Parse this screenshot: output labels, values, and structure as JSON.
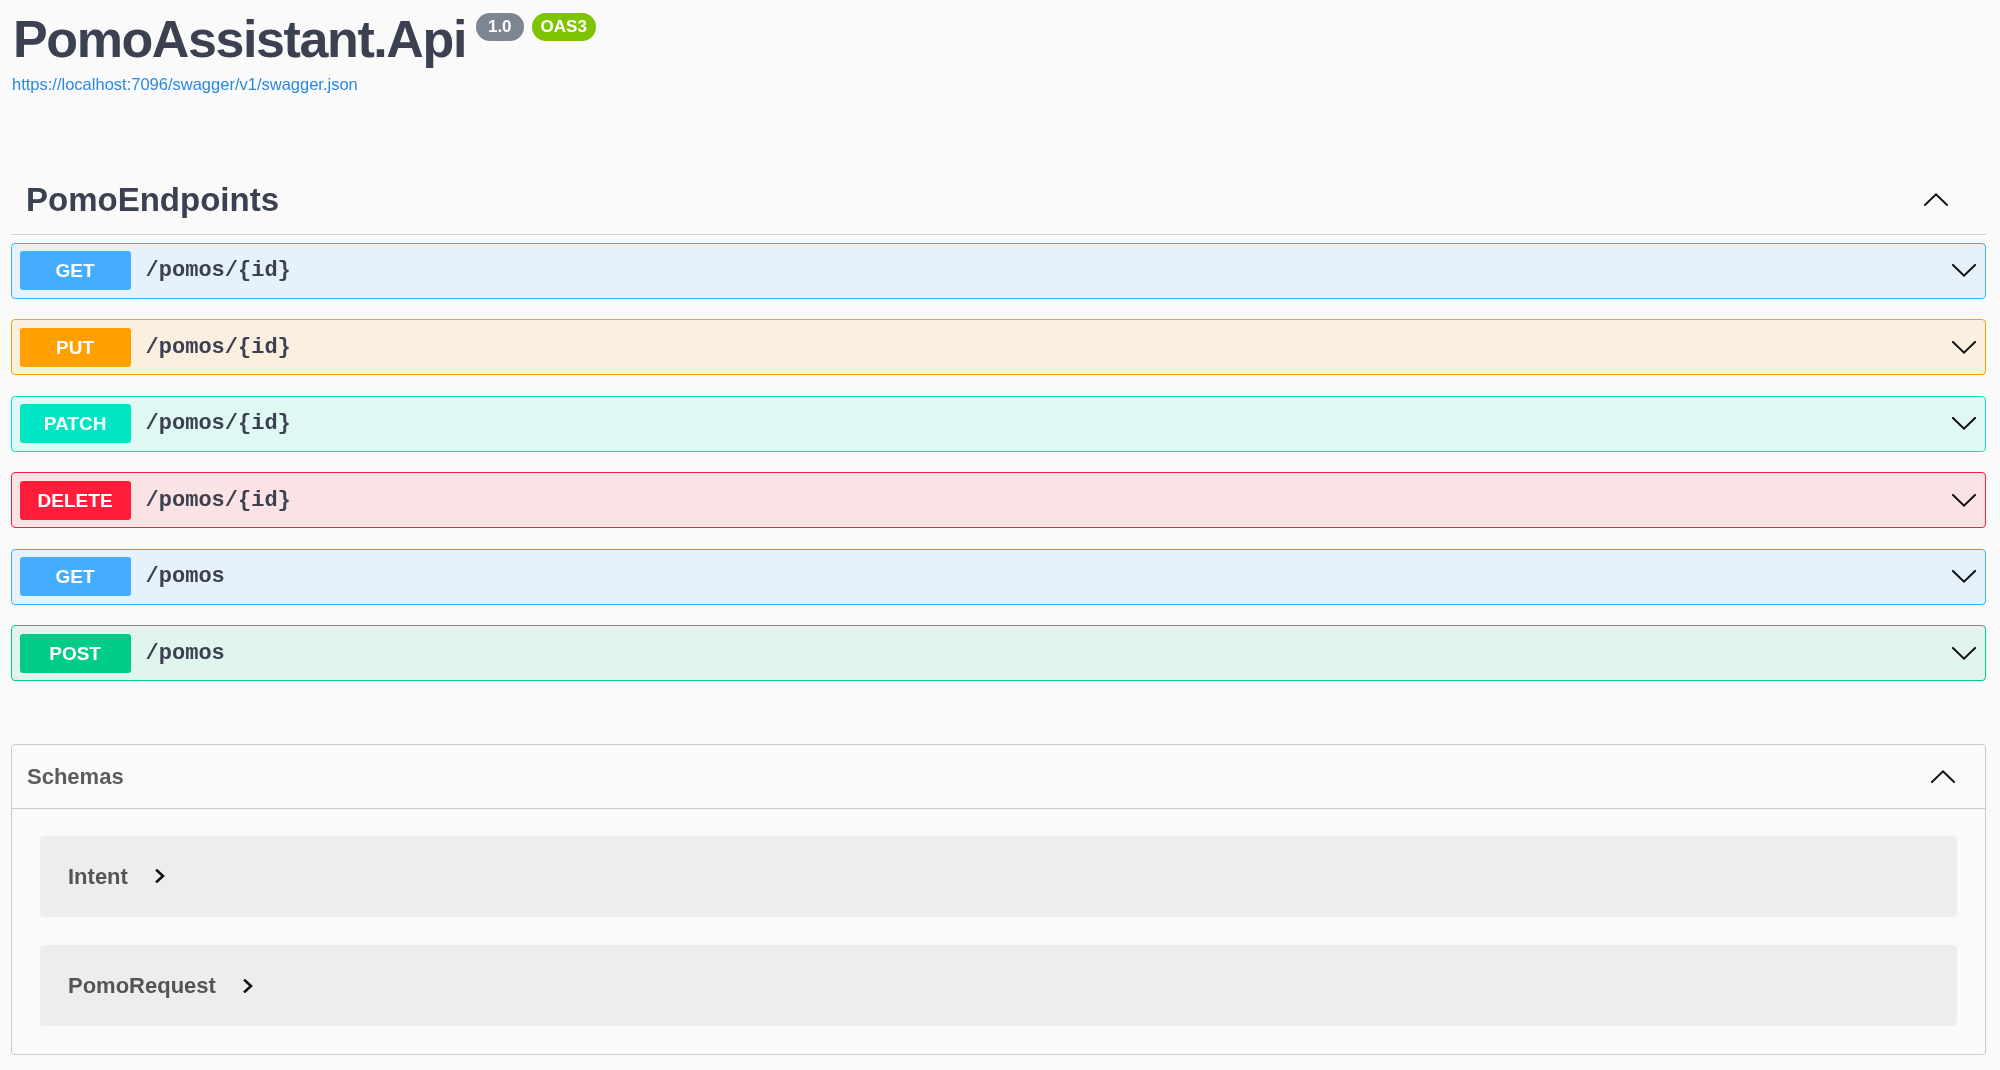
{
  "info": {
    "title": "PomoAssistant.Api",
    "version": "1.0",
    "spec_badge": "OAS3",
    "spec_url": "https://localhost:7096/swagger/v1/swagger.json"
  },
  "tag": {
    "name": "PomoEndpoints",
    "expanded": true,
    "operations": [
      {
        "method": "GET",
        "path": "/pomos/{id}",
        "color": "#45adff",
        "expanded": false
      },
      {
        "method": "PUT",
        "path": "/pomos/{id}",
        "color": "#ff9f00",
        "expanded": false
      },
      {
        "method": "PATCH",
        "path": "/pomos/{id}",
        "color": "#00e6c4",
        "expanded": false
      },
      {
        "method": "DELETE",
        "path": "/pomos/{id}",
        "color": "#ff1d3a",
        "expanded": false
      },
      {
        "method": "GET",
        "path": "/pomos",
        "color": "#45adff",
        "expanded": false
      },
      {
        "method": "POST",
        "path": "/pomos",
        "color": "#00cc85",
        "expanded": false
      }
    ]
  },
  "schemas": {
    "title": "Schemas",
    "expanded": true,
    "models": [
      {
        "name": "Intent",
        "expanded": false
      },
      {
        "name": "PomoRequest",
        "expanded": false
      }
    ]
  }
}
